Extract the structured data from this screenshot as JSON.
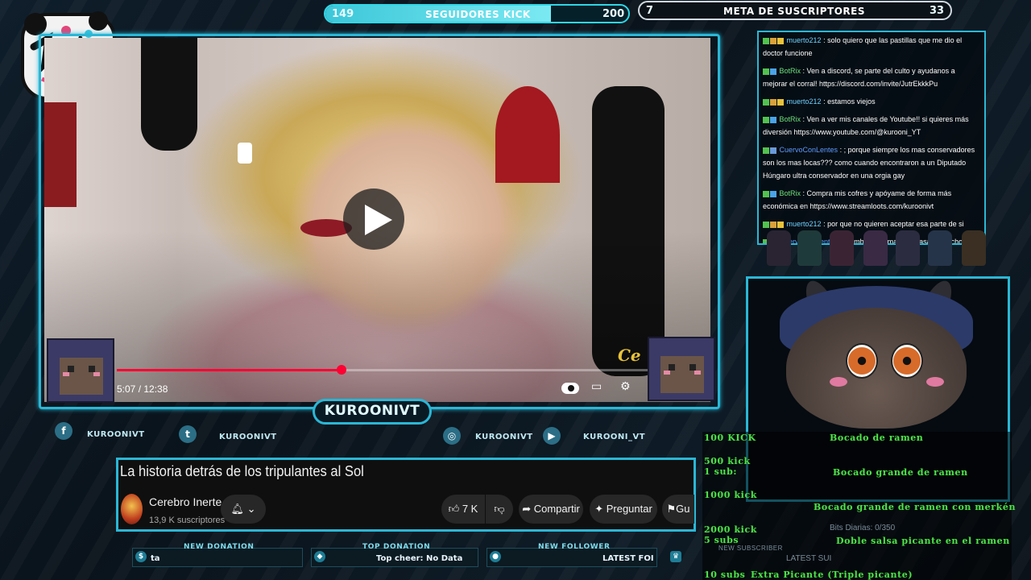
{
  "top_bar": {
    "kick": {
      "start": "149",
      "title": "SEGUIDORES KICK",
      "goal": "200",
      "progress": 0.745
    },
    "subs": {
      "start": "7",
      "title": "META DE SUSCRIPTORES",
      "goal": "33"
    }
  },
  "video": {
    "time": "5:07 / 12:38",
    "progress": 0.405,
    "watermark": "Ce"
  },
  "streamer": {
    "name": "KUROONIVT"
  },
  "socials": [
    {
      "icon": "facebook-icon",
      "glyph": "f",
      "label": "KUROONIVT"
    },
    {
      "icon": "twitter-icon",
      "glyph": "t",
      "label": "KUROONIVT"
    },
    {
      "icon": "instagram-icon",
      "glyph": "◎",
      "label": "KUROONIVT"
    },
    {
      "icon": "youtube-icon",
      "glyph": "▶",
      "label": "KUROONI_VT"
    }
  ],
  "youtube": {
    "title": "La historia detrás de los tripulantes al Sol",
    "channel": "Cerebro Inerte",
    "subscribers": "13,9 K suscriptores",
    "likes": "7 K",
    "share": "Compartir",
    "ask": "Preguntar",
    "save_partial": "Gu"
  },
  "alerts": [
    {
      "label": "NEW DONATION",
      "value": "ta"
    },
    {
      "label": "TOP DONATION",
      "value": "Top cheer: No Data"
    },
    {
      "label": "NEW FOLLOWER",
      "value": "LATEST FOI"
    }
  ],
  "chat": [
    {
      "user": "muerto212",
      "type": "muerto",
      "text": ": solo quiero que las pastillas que me dio el doctor funcione"
    },
    {
      "user": "BotRix",
      "type": "bot",
      "text": ": Ven a discord, se parte del culto y ayudanos a mejorar el corral! https://discord.com/invite/JutrEkkkPu"
    },
    {
      "user": "muerto212",
      "type": "muerto",
      "text": ": estamos viejos"
    },
    {
      "user": "BotRix",
      "type": "bot",
      "text": ": Ven a ver mis canales de Youtube!! si quieres más diversión https://www.youtube.com/@kurooni_YT"
    },
    {
      "user": "CuervoConLentes",
      "type": "cuervo",
      "text": ": ; porque siempre los mas conservadores son los mas locas??? como cuando encontraron a un Diputado Húngaro ultra conservador en una orgia gay"
    },
    {
      "user": "BotRix",
      "type": "bot",
      "text": ": Compra mis cofres y apóyame de forma más económica en https://www.streamloots.com/kuroonivt"
    },
    {
      "user": "muerto212",
      "type": "muerto",
      "text": ": por que no quieren aceptar esa parte de si"
    },
    {
      "user": "CuervoConLentes",
      "type": "cuervo",
      "text": ": ; también, es mas, ah pasado mucho"
    }
  ],
  "rewards": [
    {
      "cost": "100 KICK",
      "reward": "Bocado de ramen"
    },
    {
      "cost": "500 kick\n1 sub:",
      "reward": "Bocado grande de ramen"
    },
    {
      "cost": "1000 kick",
      "reward": "Bocado grande de ramen con merkén"
    },
    {
      "cost": "2000 kick\n5 subs",
      "reward": "Doble salsa picante en el ramen"
    },
    {
      "cost": "10 subs",
      "reward": "Extra Picante (Triple picante)"
    }
  ],
  "overlay_misc": {
    "bits": "Bits Diarias: 0/350",
    "new_subscriber": "NEW SUBSCRIBER",
    "latest_sub": "LATEST SUI"
  },
  "colors": {
    "accent": "#2ab7d6",
    "reward_green": "#4fe04a",
    "youtube_red": "#ff0033"
  }
}
